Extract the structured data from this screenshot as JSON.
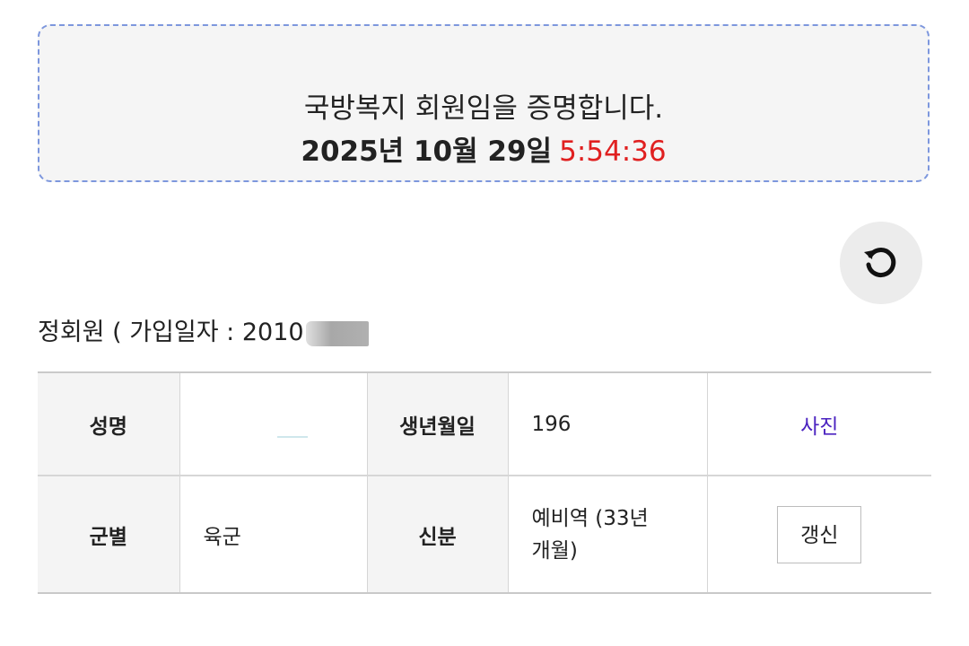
{
  "certificate": {
    "statement": "국방복지 회원임을 증명합니다.",
    "date": "2025년 10월 29일",
    "time": "5:54:36"
  },
  "member": {
    "line": "정회원 ( 가입일자 : 2010"
  },
  "info_table": {
    "name_label": "성명",
    "name_value": "",
    "birth_label": "생년월일",
    "birth_value": "196",
    "photo_link": "사진",
    "branch_label": "군별",
    "branch_value": "육군",
    "status_label": "신분",
    "status_value_line1": "예비역 (33년",
    "status_value_line2": "개월)",
    "renew_button": "갱신"
  },
  "colors": {
    "border_dashed": "#7d97dd",
    "time_red": "#e02020",
    "photo_link": "#4a22c0"
  },
  "icons": {
    "refresh": "refresh-icon"
  }
}
